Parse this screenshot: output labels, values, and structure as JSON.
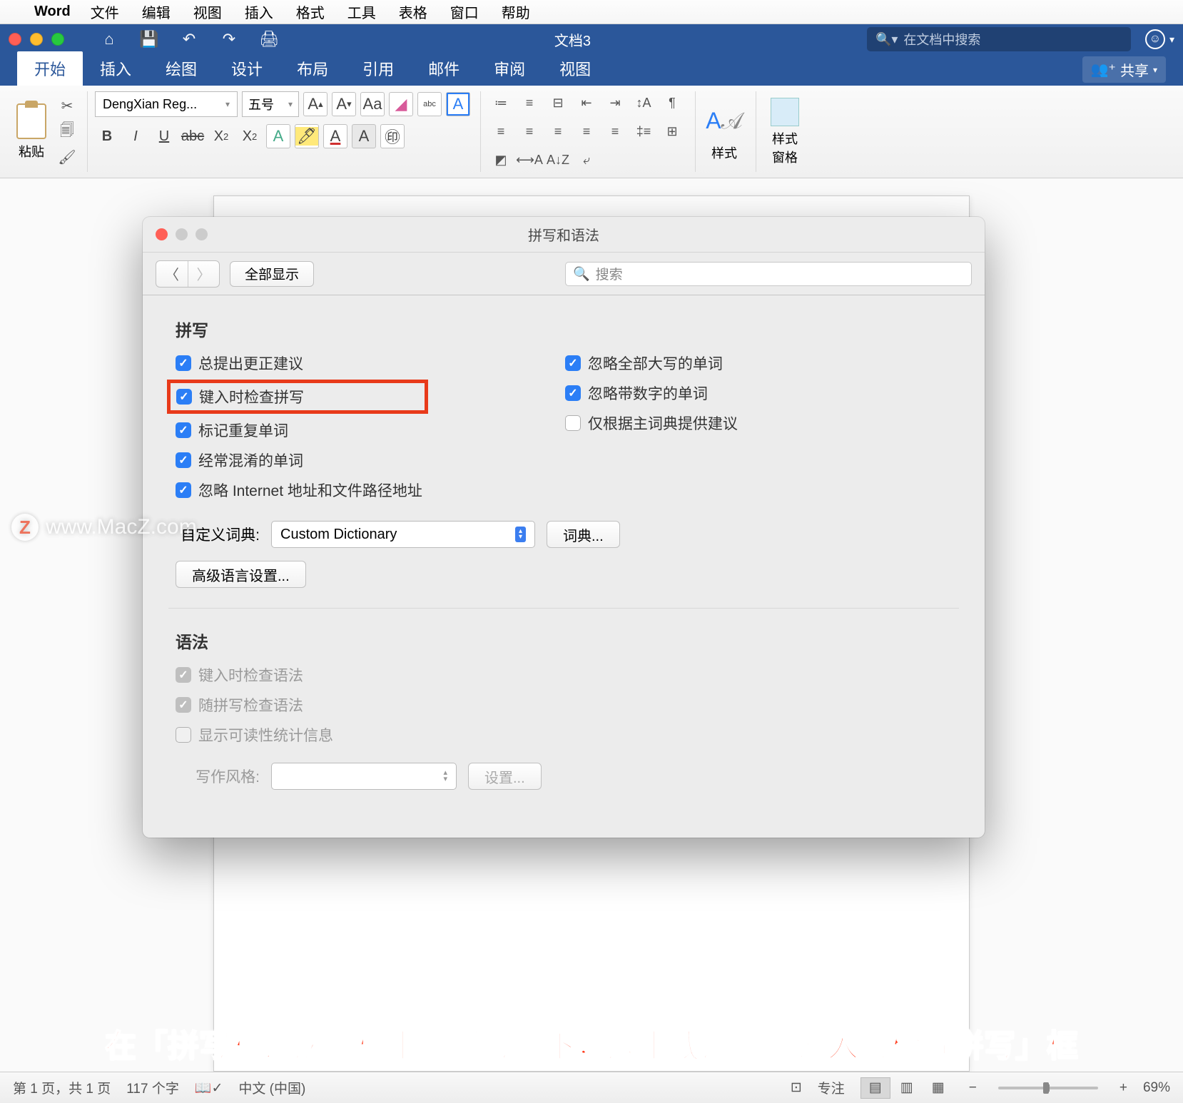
{
  "menubar": {
    "app": "Word",
    "items": [
      "文件",
      "编辑",
      "视图",
      "插入",
      "格式",
      "工具",
      "表格",
      "窗口",
      "帮助"
    ]
  },
  "titlebar": {
    "doc_title": "文档3",
    "search_placeholder": "在文档中搜索"
  },
  "ribbon_tabs": [
    "开始",
    "插入",
    "绘图",
    "设计",
    "布局",
    "引用",
    "邮件",
    "审阅",
    "视图"
  ],
  "share_label": "共享",
  "ribbon": {
    "paste_label": "粘贴",
    "font_name": "DengXian Reg...",
    "font_size": "五号",
    "styles_label": "样式",
    "styles_pane_label": "样式\n窗格"
  },
  "dialog": {
    "title": "拼写和语法",
    "show_all": "全部显示",
    "search_placeholder": "搜索",
    "spelling_title": "拼写",
    "spelling_left": [
      "总提出更正建议",
      "键入时检查拼写",
      "标记重复单词",
      "经常混淆的单词",
      "忽略 Internet 地址和文件路径地址"
    ],
    "spelling_right": [
      "忽略全部大写的单词",
      "忽略带数字的单词",
      "仅根据主词典提供建议"
    ],
    "custom_dict_label": "自定义词典:",
    "custom_dict_value": "Custom Dictionary",
    "dict_btn": "词典...",
    "advanced_lang_btn": "高级语言设置...",
    "grammar_title": "语法",
    "grammar_checks": [
      "键入时检查语法",
      "随拼写检查语法",
      "显示可读性统计信息"
    ],
    "writing_style_label": "写作风格:",
    "settings_btn": "设置..."
  },
  "annotation": "在「拼写和语法」框中「拼写」下，选中或清除「键入时检查拼写」框",
  "watermark": "www.MacZ.com",
  "statusbar": {
    "page": "第 1 页，共 1 页",
    "words": "117 个字",
    "lang": "中文 (中国)",
    "focus": "专注",
    "zoom": "69%"
  }
}
